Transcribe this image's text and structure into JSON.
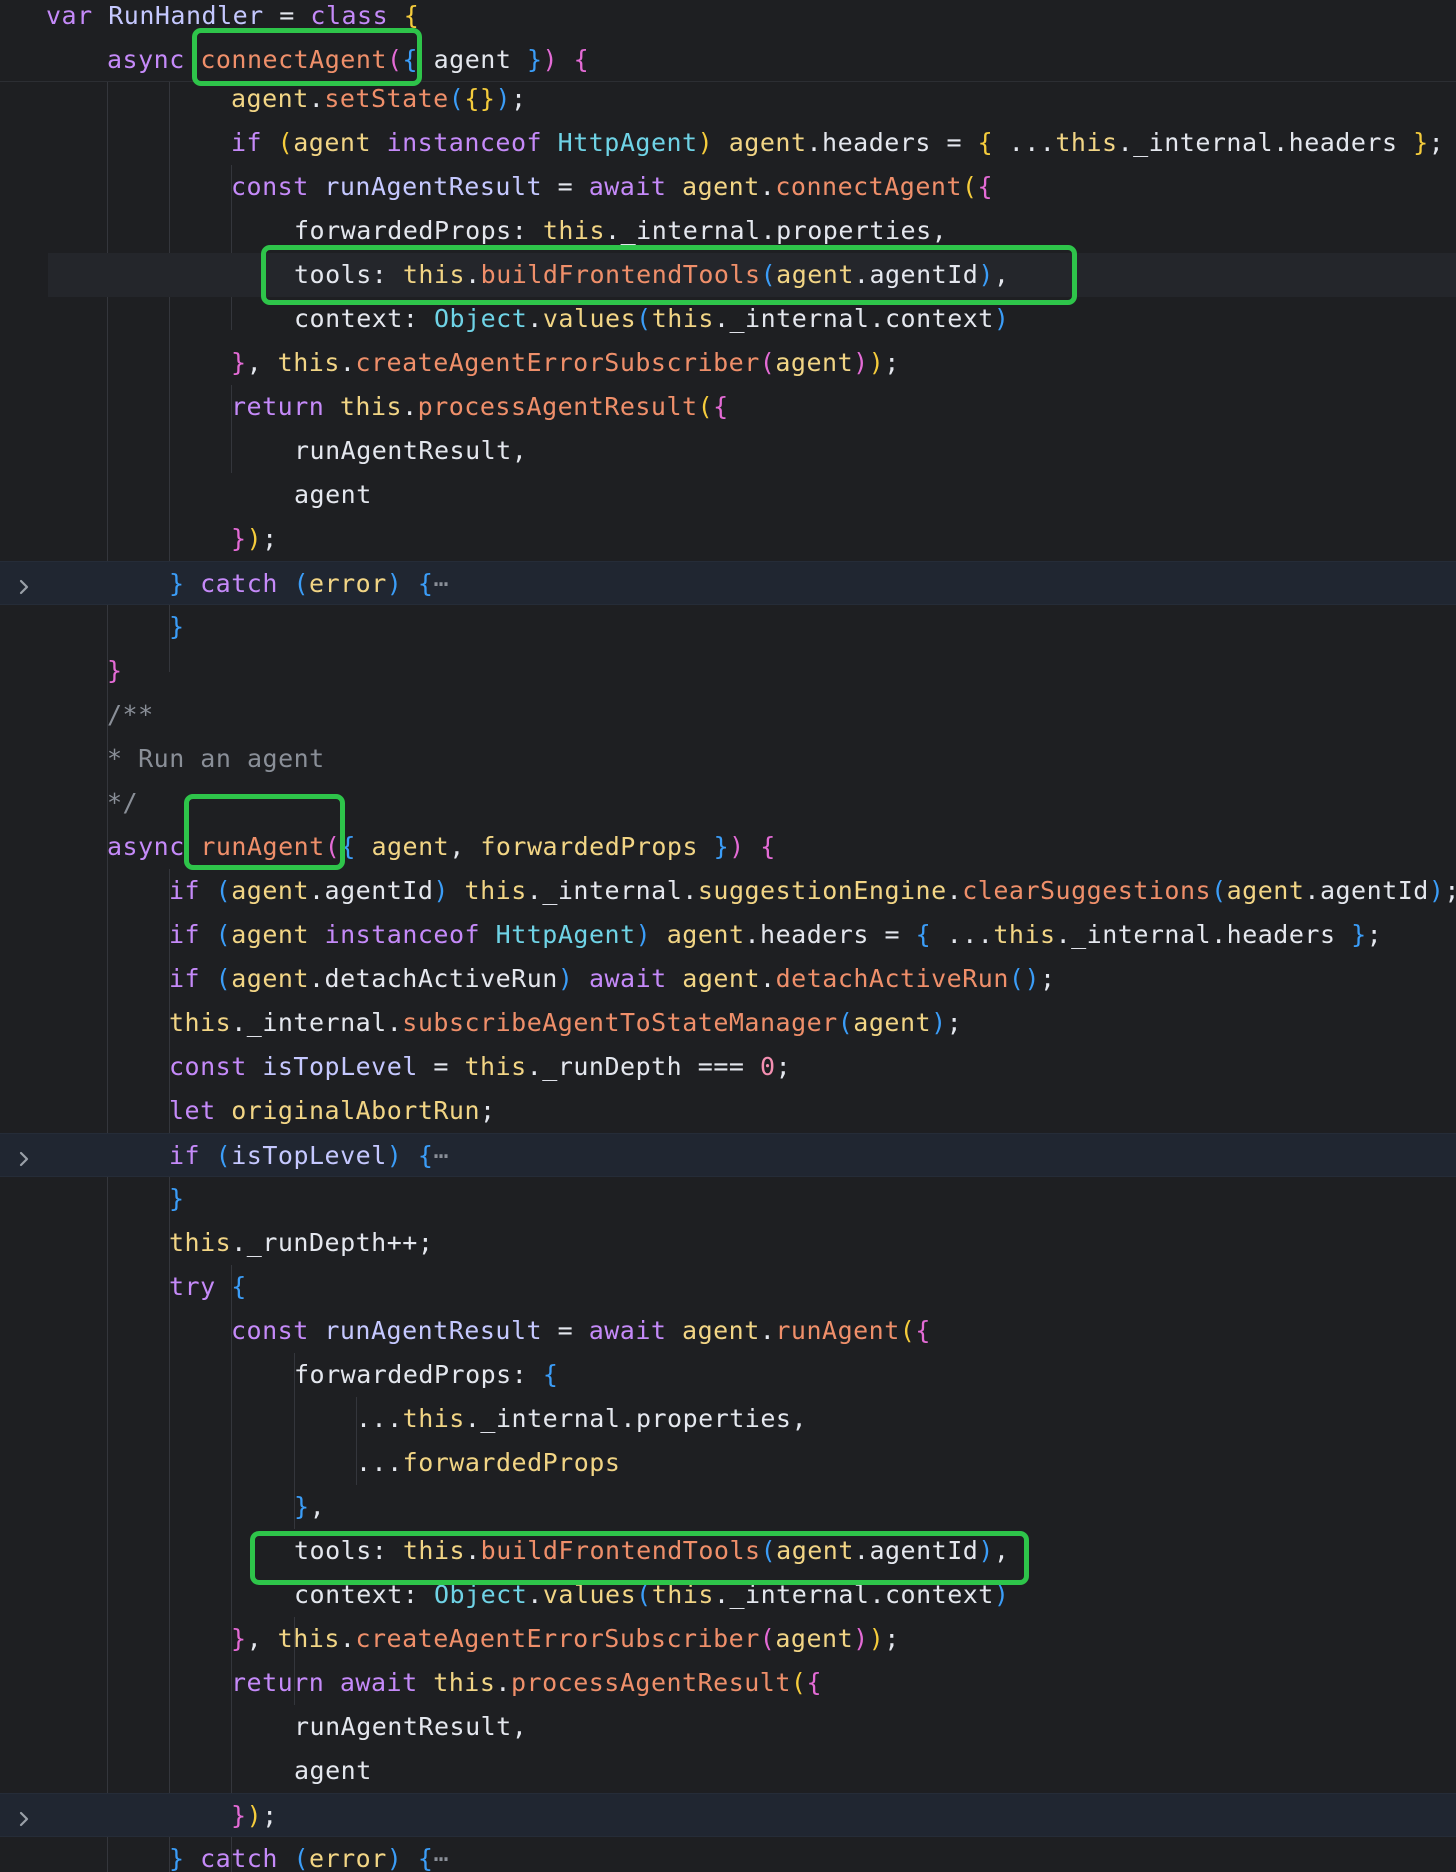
{
  "editor": {
    "lines": [
      [
        [
          "kw",
          "var"
        ],
        [
          "p",
          " "
        ],
        [
          "var",
          "RunHandler"
        ],
        [
          "p",
          " = "
        ],
        [
          "kw",
          "class"
        ],
        [
          "p",
          " "
        ],
        [
          "b1",
          "{"
        ]
      ],
      [
        [
          "kw",
          "async"
        ],
        [
          "p",
          " "
        ],
        [
          "fn",
          "connectAgent"
        ],
        [
          "b2",
          "("
        ],
        [
          "b3",
          "{"
        ],
        [
          "p",
          " agent "
        ],
        [
          "b3",
          "}"
        ],
        [
          "b2",
          ")"
        ],
        [
          "p",
          " "
        ],
        [
          "b2",
          "{"
        ]
      ],
      [
        [
          "id",
          "agent"
        ],
        [
          "p",
          "."
        ],
        [
          "fn",
          "setState"
        ],
        [
          "b3",
          "("
        ],
        [
          "b1",
          "{"
        ],
        [
          "b1",
          "}"
        ],
        [
          "b3",
          ")"
        ],
        [
          "p",
          ";"
        ]
      ],
      [
        [
          "kw",
          "if"
        ],
        [
          "p",
          " "
        ],
        [
          "b1",
          "("
        ],
        [
          "id",
          "agent"
        ],
        [
          "p",
          " "
        ],
        [
          "kw",
          "instanceof"
        ],
        [
          "p",
          " "
        ],
        [
          "cls",
          "HttpAgent"
        ],
        [
          "b1",
          ")"
        ],
        [
          "p",
          " "
        ],
        [
          "id",
          "agent"
        ],
        [
          "p",
          ".headers = "
        ],
        [
          "b1",
          "{"
        ],
        [
          "p",
          " ..."
        ],
        [
          "this",
          "this"
        ],
        [
          "p",
          "._internal.headers "
        ],
        [
          "b1",
          "}"
        ],
        [
          "p",
          ";"
        ]
      ],
      [
        [
          "kw",
          "const"
        ],
        [
          "p",
          " "
        ],
        [
          "var",
          "runAgentResult"
        ],
        [
          "p",
          " = "
        ],
        [
          "kw",
          "await"
        ],
        [
          "p",
          " "
        ],
        [
          "id",
          "agent"
        ],
        [
          "p",
          "."
        ],
        [
          "fn",
          "connectAgent"
        ],
        [
          "b1",
          "("
        ],
        [
          "b2",
          "{"
        ]
      ],
      [
        [
          "p",
          "forwardedProps: "
        ],
        [
          "this",
          "this"
        ],
        [
          "p",
          "._internal.properties,"
        ]
      ],
      [
        [
          "p",
          "tools: "
        ],
        [
          "this",
          "this"
        ],
        [
          "p",
          "."
        ],
        [
          "fn",
          "buildFrontendTools"
        ],
        [
          "b3",
          "("
        ],
        [
          "id",
          "agent"
        ],
        [
          "p",
          ".agentId"
        ],
        [
          "b3",
          ")"
        ],
        [
          "p",
          ","
        ]
      ],
      [
        [
          "p",
          "context: "
        ],
        [
          "cls",
          "Object"
        ],
        [
          "p",
          "."
        ],
        [
          "id",
          "values"
        ],
        [
          "b3",
          "("
        ],
        [
          "this",
          "this"
        ],
        [
          "p",
          "._internal.context"
        ],
        [
          "b3",
          ")"
        ]
      ],
      [
        [
          "b2",
          "}"
        ],
        [
          "p",
          ", "
        ],
        [
          "this",
          "this"
        ],
        [
          "p",
          "."
        ],
        [
          "fn",
          "createAgentErrorSubscriber"
        ],
        [
          "b2",
          "("
        ],
        [
          "id",
          "agent"
        ],
        [
          "b2",
          ")"
        ],
        [
          "b1",
          ")"
        ],
        [
          "p",
          ";"
        ]
      ],
      [
        [
          "kw",
          "return"
        ],
        [
          "p",
          " "
        ],
        [
          "this",
          "this"
        ],
        [
          "p",
          "."
        ],
        [
          "fn",
          "processAgentResult"
        ],
        [
          "b1",
          "("
        ],
        [
          "b2",
          "{"
        ]
      ],
      [
        [
          "p",
          "runAgentResult,"
        ]
      ],
      [
        [
          "p",
          "agent"
        ]
      ],
      [
        [
          "b2",
          "}"
        ],
        [
          "b1",
          ")"
        ],
        [
          "p",
          ";"
        ]
      ],
      [
        [
          "b3",
          "}"
        ],
        [
          "p",
          " "
        ],
        [
          "kw",
          "catch"
        ],
        [
          "p",
          " "
        ],
        [
          "b3",
          "("
        ],
        [
          "id",
          "error"
        ],
        [
          "b3",
          ")"
        ],
        [
          "p",
          " "
        ],
        [
          "b3",
          "{"
        ],
        [
          "fold",
          "⋯"
        ]
      ],
      [
        [
          "b3",
          "}"
        ]
      ],
      [
        [
          "b2",
          "}"
        ]
      ],
      [
        [
          "cm",
          "/**"
        ]
      ],
      [
        [
          "cm",
          "* Run an agent"
        ]
      ],
      [
        [
          "cm",
          "*/"
        ]
      ],
      [
        [
          "kw",
          "async"
        ],
        [
          "p",
          " "
        ],
        [
          "fn",
          "runAgent"
        ],
        [
          "b2",
          "("
        ],
        [
          "b3",
          "{"
        ],
        [
          "p",
          " "
        ],
        [
          "id",
          "agent"
        ],
        [
          "p",
          ", "
        ],
        [
          "id",
          "forwardedProps"
        ],
        [
          "p",
          " "
        ],
        [
          "b3",
          "}"
        ],
        [
          "b2",
          ")"
        ],
        [
          "p",
          " "
        ],
        [
          "b2",
          "{"
        ]
      ],
      [
        [
          "kw",
          "if"
        ],
        [
          "p",
          " "
        ],
        [
          "b3",
          "("
        ],
        [
          "id",
          "agent"
        ],
        [
          "p",
          ".agentId"
        ],
        [
          "b3",
          ")"
        ],
        [
          "p",
          " "
        ],
        [
          "this",
          "this"
        ],
        [
          "p",
          "._internal."
        ],
        [
          "id",
          "suggestionEngine"
        ],
        [
          "p",
          "."
        ],
        [
          "fn",
          "clearSuggestions"
        ],
        [
          "b3",
          "("
        ],
        [
          "id",
          "agent"
        ],
        [
          "p",
          ".agentId"
        ],
        [
          "b3",
          ")"
        ],
        [
          "p",
          ";"
        ]
      ],
      [
        [
          "kw",
          "if"
        ],
        [
          "p",
          " "
        ],
        [
          "b3",
          "("
        ],
        [
          "id",
          "agent"
        ],
        [
          "p",
          " "
        ],
        [
          "kw",
          "instanceof"
        ],
        [
          "p",
          " "
        ],
        [
          "cls",
          "HttpAgent"
        ],
        [
          "b3",
          ")"
        ],
        [
          "p",
          " "
        ],
        [
          "id",
          "agent"
        ],
        [
          "p",
          ".headers = "
        ],
        [
          "b3",
          "{"
        ],
        [
          "p",
          " ..."
        ],
        [
          "this",
          "this"
        ],
        [
          "p",
          "._internal.headers "
        ],
        [
          "b3",
          "}"
        ],
        [
          "p",
          ";"
        ]
      ],
      [
        [
          "kw",
          "if"
        ],
        [
          "p",
          " "
        ],
        [
          "b3",
          "("
        ],
        [
          "id",
          "agent"
        ],
        [
          "p",
          ".detachActiveRun"
        ],
        [
          "b3",
          ")"
        ],
        [
          "p",
          " "
        ],
        [
          "kw",
          "await"
        ],
        [
          "p",
          " "
        ],
        [
          "id",
          "agent"
        ],
        [
          "p",
          "."
        ],
        [
          "fn",
          "detachActiveRun"
        ],
        [
          "b3",
          "("
        ],
        [
          "b3",
          ")"
        ],
        [
          "p",
          ";"
        ]
      ],
      [
        [
          "this",
          "this"
        ],
        [
          "p",
          "._internal."
        ],
        [
          "fn",
          "subscribeAgentToStateManager"
        ],
        [
          "b3",
          "("
        ],
        [
          "id",
          "agent"
        ],
        [
          "b3",
          ")"
        ],
        [
          "p",
          ";"
        ]
      ],
      [
        [
          "kw",
          "const"
        ],
        [
          "p",
          " "
        ],
        [
          "var",
          "isTopLevel"
        ],
        [
          "p",
          " = "
        ],
        [
          "this",
          "this"
        ],
        [
          "p",
          "._runDepth === "
        ],
        [
          "num",
          "0"
        ],
        [
          "p",
          ";"
        ]
      ],
      [
        [
          "kw",
          "let"
        ],
        [
          "p",
          " "
        ],
        [
          "id",
          "originalAbortRun"
        ],
        [
          "p",
          ";"
        ]
      ],
      [
        [
          "kw",
          "if"
        ],
        [
          "p",
          " "
        ],
        [
          "b3",
          "("
        ],
        [
          "var",
          "isTopLevel"
        ],
        [
          "b3",
          ")"
        ],
        [
          "p",
          " "
        ],
        [
          "b3",
          "{"
        ],
        [
          "fold",
          "⋯"
        ]
      ],
      [
        [
          "b3",
          "}"
        ]
      ],
      [
        [
          "this",
          "this"
        ],
        [
          "p",
          "._runDepth++;"
        ]
      ],
      [
        [
          "kw",
          "try"
        ],
        [
          "p",
          " "
        ],
        [
          "b3",
          "{"
        ]
      ],
      [
        [
          "kw",
          "const"
        ],
        [
          "p",
          " "
        ],
        [
          "var",
          "runAgentResult"
        ],
        [
          "p",
          " = "
        ],
        [
          "kw",
          "await"
        ],
        [
          "p",
          " "
        ],
        [
          "id",
          "agent"
        ],
        [
          "p",
          "."
        ],
        [
          "fn",
          "runAgent"
        ],
        [
          "b1",
          "("
        ],
        [
          "b2",
          "{"
        ]
      ],
      [
        [
          "p",
          "forwardedProps: "
        ],
        [
          "b3",
          "{"
        ]
      ],
      [
        [
          "p",
          "..."
        ],
        [
          "this",
          "this"
        ],
        [
          "p",
          "._internal.properties,"
        ]
      ],
      [
        [
          "p",
          "..."
        ],
        [
          "id",
          "forwardedProps"
        ]
      ],
      [
        [
          "b3",
          "}"
        ],
        [
          "p",
          ","
        ]
      ],
      [
        [
          "p",
          "tools: "
        ],
        [
          "this",
          "this"
        ],
        [
          "p",
          "."
        ],
        [
          "fn",
          "buildFrontendTools"
        ],
        [
          "b3",
          "("
        ],
        [
          "id",
          "agent"
        ],
        [
          "p",
          ".agentId"
        ],
        [
          "b3",
          ")"
        ],
        [
          "p",
          ","
        ]
      ],
      [
        [
          "p",
          "context: "
        ],
        [
          "cls",
          "Object"
        ],
        [
          "p",
          "."
        ],
        [
          "id",
          "values"
        ],
        [
          "b3",
          "("
        ],
        [
          "this",
          "this"
        ],
        [
          "p",
          "._internal.context"
        ],
        [
          "b3",
          ")"
        ]
      ],
      [
        [
          "b2",
          "}"
        ],
        [
          "p",
          ", "
        ],
        [
          "this",
          "this"
        ],
        [
          "p",
          "."
        ],
        [
          "fn",
          "createAgentErrorSubscriber"
        ],
        [
          "b2",
          "("
        ],
        [
          "id",
          "agent"
        ],
        [
          "b2",
          ")"
        ],
        [
          "b1",
          ")"
        ],
        [
          "p",
          ";"
        ]
      ],
      [
        [
          "kw",
          "return"
        ],
        [
          "p",
          " "
        ],
        [
          "kw",
          "await"
        ],
        [
          "p",
          " "
        ],
        [
          "this",
          "this"
        ],
        [
          "p",
          "."
        ],
        [
          "fn",
          "processAgentResult"
        ],
        [
          "b1",
          "("
        ],
        [
          "b2",
          "{"
        ]
      ],
      [
        [
          "p",
          "runAgentResult,"
        ]
      ],
      [
        [
          "p",
          "agent"
        ]
      ],
      [
        [
          "b2",
          "}"
        ],
        [
          "b1",
          ")"
        ],
        [
          "p",
          ";"
        ]
      ],
      [
        [
          "b3",
          "}"
        ],
        [
          "p",
          " "
        ],
        [
          "kw",
          "catch"
        ],
        [
          "p",
          " "
        ],
        [
          "b3",
          "("
        ],
        [
          "id",
          "error"
        ],
        [
          "b3",
          ")"
        ],
        [
          "p",
          " "
        ],
        [
          "b3",
          "{"
        ],
        [
          "fold",
          "⋯"
        ]
      ]
    ],
    "folded_lines": [
      13,
      26,
      41
    ],
    "current_line": 6
  }
}
